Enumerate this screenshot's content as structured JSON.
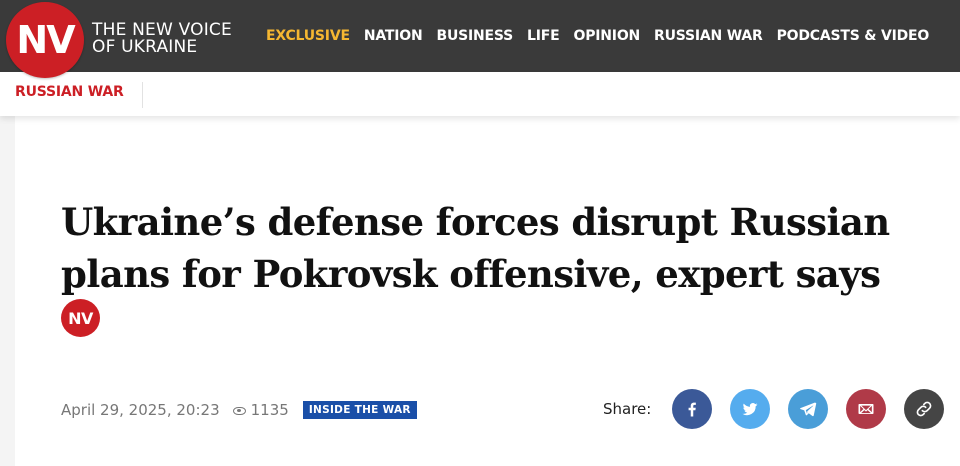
{
  "brand": {
    "logo": "NV",
    "name_line1": "THE NEW VOICE",
    "name_line2": "OF UKRAINE"
  },
  "nav": {
    "items": [
      {
        "label": "EXCLUSIVE",
        "active": true
      },
      {
        "label": "NATION"
      },
      {
        "label": "BUSINESS"
      },
      {
        "label": "LIFE"
      },
      {
        "label": "OPINION"
      },
      {
        "label": "RUSSIAN WAR"
      },
      {
        "label": "PODCASTS & VIDEO"
      }
    ]
  },
  "section": {
    "label": "RUSSIAN WAR"
  },
  "article": {
    "headline": "Ukraine’s defense forces disrupt Russian plans for Pokrovsk offensive, expert says",
    "author_avatar": "NV",
    "date": "April 29, 2025, 20:23",
    "views": "1135",
    "tag": "INSIDE THE WAR"
  },
  "share": {
    "label": "Share:",
    "buttons": [
      {
        "icon": "facebook-icon",
        "color": "#3b5998"
      },
      {
        "icon": "twitter-icon",
        "color": "#55acee"
      },
      {
        "icon": "telegram-icon",
        "color": "#4a9ed8"
      },
      {
        "icon": "email-icon",
        "color": "#b03a48"
      },
      {
        "icon": "link-icon",
        "color": "#454545"
      }
    ]
  },
  "colors": {
    "brand_red": "#cc1f25",
    "topbar": "#3a3a3a",
    "nav_active": "#f5b731",
    "tag_blue": "#1a4fa8"
  }
}
